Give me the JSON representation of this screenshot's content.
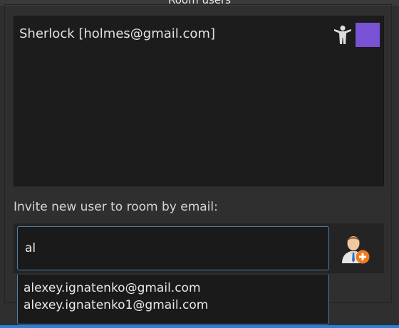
{
  "group": {
    "title": "Room users"
  },
  "users": [
    {
      "display": "Sherlock [holmes@gmail.com]",
      "icon": "person-icon",
      "color": "#7a52d6"
    }
  ],
  "invite": {
    "label": "Invite new user to room by email:",
    "input_value": "al",
    "add_icon": "add-user-icon"
  },
  "suggestions": [
    "alexey.ignatenko@gmail.com",
    "alexey.ignatenko1@gmail.com"
  ],
  "colors": {
    "accent": "#4d7fb0",
    "highlight_bar": "#2b7fd6",
    "user_swatch": "#7a52d6"
  }
}
